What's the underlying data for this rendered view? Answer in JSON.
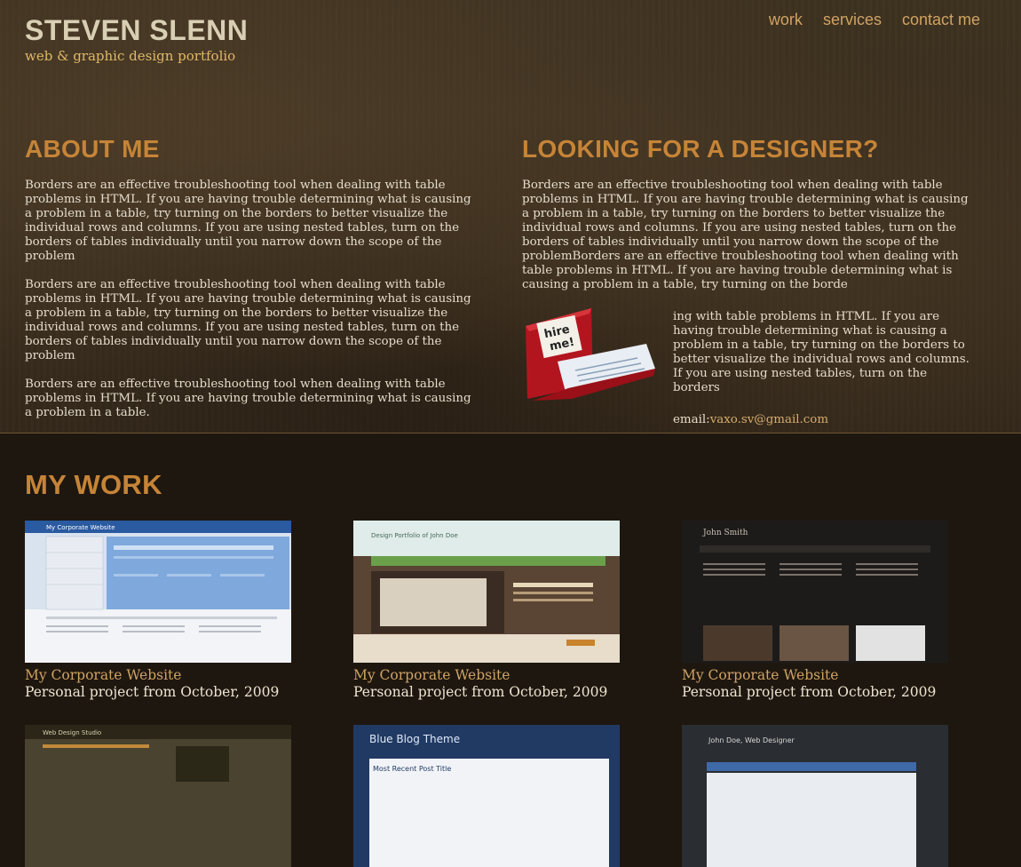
{
  "header": {
    "name": "STEVEN SLENN",
    "tagline": "web & graphic design portfolio",
    "nav": [
      {
        "label": "work"
      },
      {
        "label": "services"
      },
      {
        "label": "contact me"
      }
    ]
  },
  "about": {
    "heading": "ABOUT ME",
    "paragraphs": [
      "Borders are an effective troubleshooting tool when dealing with table problems in HTML. If you are having trouble determining what is causing a problem in a table, try turning on the borders to better visualize the individual rows and columns. If you are using nested tables, turn on the borders of tables individually until you narrow down the scope of the problem",
      "Borders are an effective troubleshooting tool when dealing with table problems in HTML. If you are having trouble determining what is causing a problem in a table, try turning on the borders to better visualize the individual rows and columns. If you are using nested tables, turn on the borders of tables individually until you narrow down the scope of the problem",
      "Borders are an effective troubleshooting tool when dealing with table problems in HTML. If you are having trouble determining what is causing a problem in a table."
    ]
  },
  "hire": {
    "heading": "LOOKING FOR A DESIGNER?",
    "paragraph": "Borders are an effective troubleshooting tool when dealing with table problems in HTML. If you are having trouble determining what is causing a problem in a table, try turning on the borders to better visualize the individual rows and columns. If you are using nested tables, turn on the borders of tables individually until you narrow down the scope of the problemBorders are an effective troubleshooting tool when dealing with table problems in HTML. If you are having trouble determining what is causing a problem in a table, try turning on the borde",
    "side_text": "ing with table problems in HTML. If you are having trouble determining what is causing a problem in a table, try turning on the borders to better visualize the individual rows and columns. If you are using nested tables, turn on the borders",
    "email_label": "email:",
    "email": "vaxo.sv@gmail.com",
    "icon_text_1": "hire",
    "icon_text_2": "me!"
  },
  "work": {
    "heading": "MY WORK",
    "items": [
      {
        "title": "My Corporate Website",
        "subtitle": "Personal project from October, 2009"
      },
      {
        "title": "My Corporate Website",
        "subtitle": "Personal project from October, 2009"
      },
      {
        "title": "My Corporate Website",
        "subtitle": "Personal project from October, 2009"
      }
    ],
    "thumbs": {
      "t1_title": "My Corporate Website",
      "t2_title": "Design Portfolio of John Doe",
      "t3_title": "John Smith",
      "t4_title": "Web Design Studio",
      "t5_title": "Blue Blog Theme",
      "t5_sub": "Most Recent Post Title",
      "t6_title": "John Doe, Web Designer"
    }
  }
}
